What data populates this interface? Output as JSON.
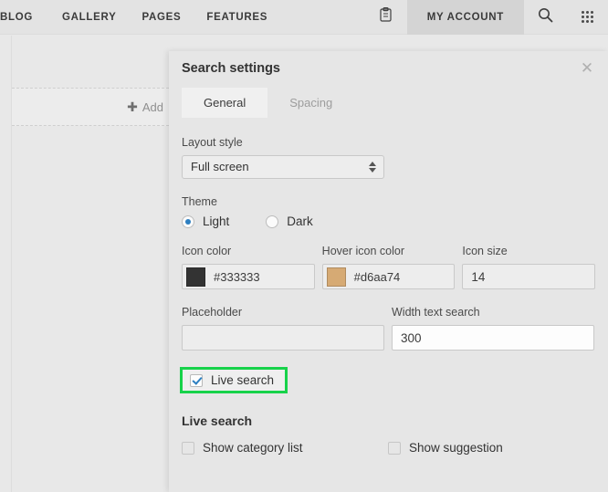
{
  "site_nav": {
    "links": [
      {
        "label": "BLOG",
        "name": "nav-link-blog"
      },
      {
        "label": "GALLERY",
        "name": "nav-link-gallery"
      },
      {
        "label": "PAGES",
        "name": "nav-link-pages"
      },
      {
        "label": "FEATURES",
        "name": "nav-link-features"
      }
    ],
    "clipboard_icon": "clipboard-icon",
    "my_account_label": "MY ACCOUNT",
    "search_icon": "search-icon",
    "apps_grid_icon": "apps-grid-icon",
    "active_tab_bg": "#d4d4d4"
  },
  "canvas": {
    "add_row_label": "Add",
    "add_plus_icon": "plus-icon"
  },
  "panel": {
    "title": "Search settings",
    "close_icon": "close-icon",
    "tabs": [
      {
        "label": "General",
        "active": true
      },
      {
        "label": "Spacing",
        "active": false
      }
    ],
    "layout_style": {
      "label": "Layout style",
      "value": "Full screen",
      "stepper_icon": "stepper-arrows-icon"
    },
    "theme": {
      "label": "Theme",
      "options": [
        {
          "label": "Light",
          "selected": true
        },
        {
          "label": "Dark",
          "selected": false
        }
      ],
      "selected_color": "#2d7fc1"
    },
    "icon_color": {
      "label": "Icon color",
      "value": "#333333",
      "swatch": "#333333"
    },
    "hover_icon_color": {
      "label": "Hover icon color",
      "value": "#d6aa74",
      "swatch": "#d6aa74"
    },
    "icon_size": {
      "label": "Icon size",
      "value": "14"
    },
    "placeholder_field": {
      "label": "Placeholder",
      "value": "",
      "placeholder": ""
    },
    "width_text_search": {
      "label": "Width text search",
      "value": "300"
    },
    "live_search_toggle": {
      "label": "Live search",
      "checked": true,
      "highlight_color": "#17d24a"
    },
    "live_search_section": {
      "title": "Live search",
      "options": [
        {
          "label": "Show category list",
          "checked": false
        },
        {
          "label": "Show suggestion",
          "checked": false
        }
      ]
    }
  }
}
